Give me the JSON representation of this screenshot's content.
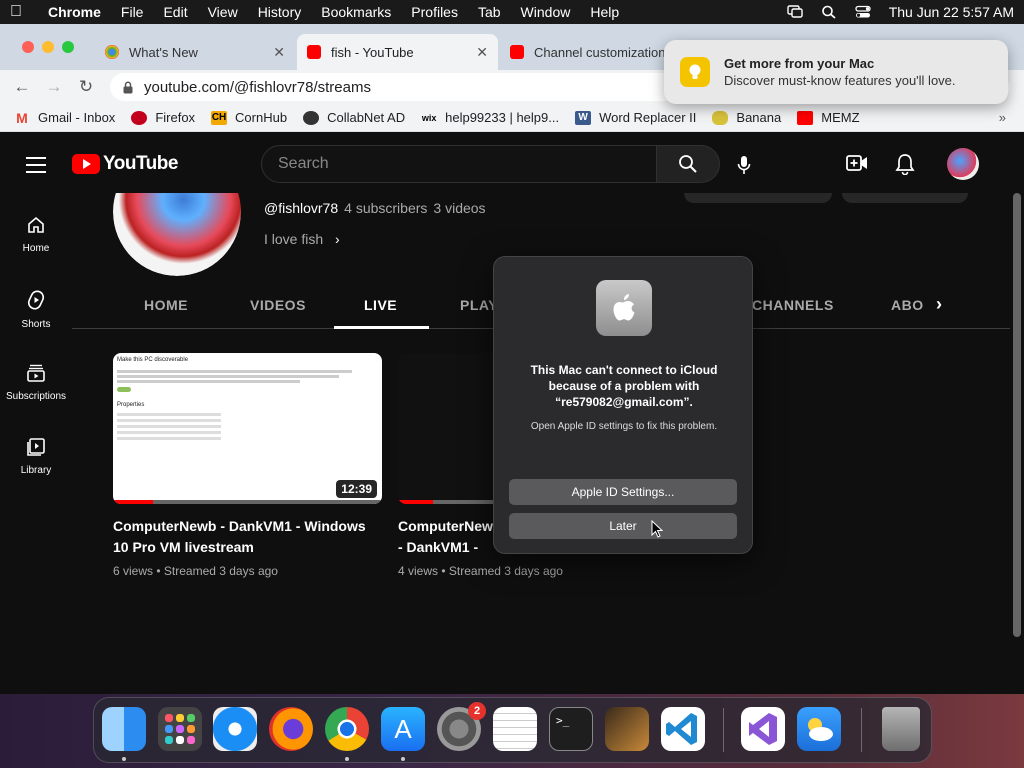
{
  "menubar": {
    "app": "Chrome",
    "items": [
      "File",
      "Edit",
      "View",
      "History",
      "Bookmarks",
      "Profiles",
      "Tab",
      "Window",
      "Help"
    ],
    "clock": "Thu Jun 22  5:57 AM"
  },
  "tabs": [
    {
      "title": "What's New"
    },
    {
      "title": "fish - YouTube"
    },
    {
      "title": "Channel customization"
    }
  ],
  "omnibox": {
    "url": "youtube.com/@fishlovr78/streams"
  },
  "bookmarks": [
    {
      "label": "Gmail - Inbox"
    },
    {
      "label": "Firefox"
    },
    {
      "label": "CornHub"
    },
    {
      "label": "CollabNet AD"
    },
    {
      "label": "help99233 | help9..."
    },
    {
      "label": "Word Replacer II"
    },
    {
      "label": "Banana"
    },
    {
      "label": "MEMZ"
    }
  ],
  "notification": {
    "title": "Get more from your Mac",
    "body": "Discover must-know features you'll love."
  },
  "youtube": {
    "logo": "YouTube",
    "search_placeholder": "Search",
    "sidebar": [
      {
        "label": "Home"
      },
      {
        "label": "Shorts"
      },
      {
        "label": "Subscriptions"
      },
      {
        "label": "Library"
      }
    ],
    "channel": {
      "handle": "@fishlovr78",
      "subscribers": "4 subscribers",
      "videos": "3 videos",
      "bio": "I love fish"
    },
    "channel_tabs": [
      "HOME",
      "VIDEOS",
      "LIVE",
      "PLAY",
      "CHANNELS",
      "ABO"
    ],
    "videos": [
      {
        "title": "ComputerNewb - DankVM1 - Windows 10 Pro VM livestream",
        "views": "6 views",
        "streamed": "Streamed 3 days ago",
        "duration": "12:39",
        "thumb_text": "Make this PC discoverable",
        "thumb_section": "Properties",
        "progress": 0.15
      },
      {
        "title": "ComputerNewb - DankVM1 - Windows 10 Pro VM livestream",
        "views": "4 views",
        "streamed": "Streamed 3 days ago",
        "progress": 0.13
      }
    ]
  },
  "dialog": {
    "title": "This Mac can't connect to iCloud because of a problem with “re579082@gmail.com”.",
    "body": "Open Apple ID settings to fix this problem.",
    "primary_label": "Apple ID Settings...",
    "secondary_label": "Later"
  },
  "dock": {
    "settings_badge": "2"
  }
}
